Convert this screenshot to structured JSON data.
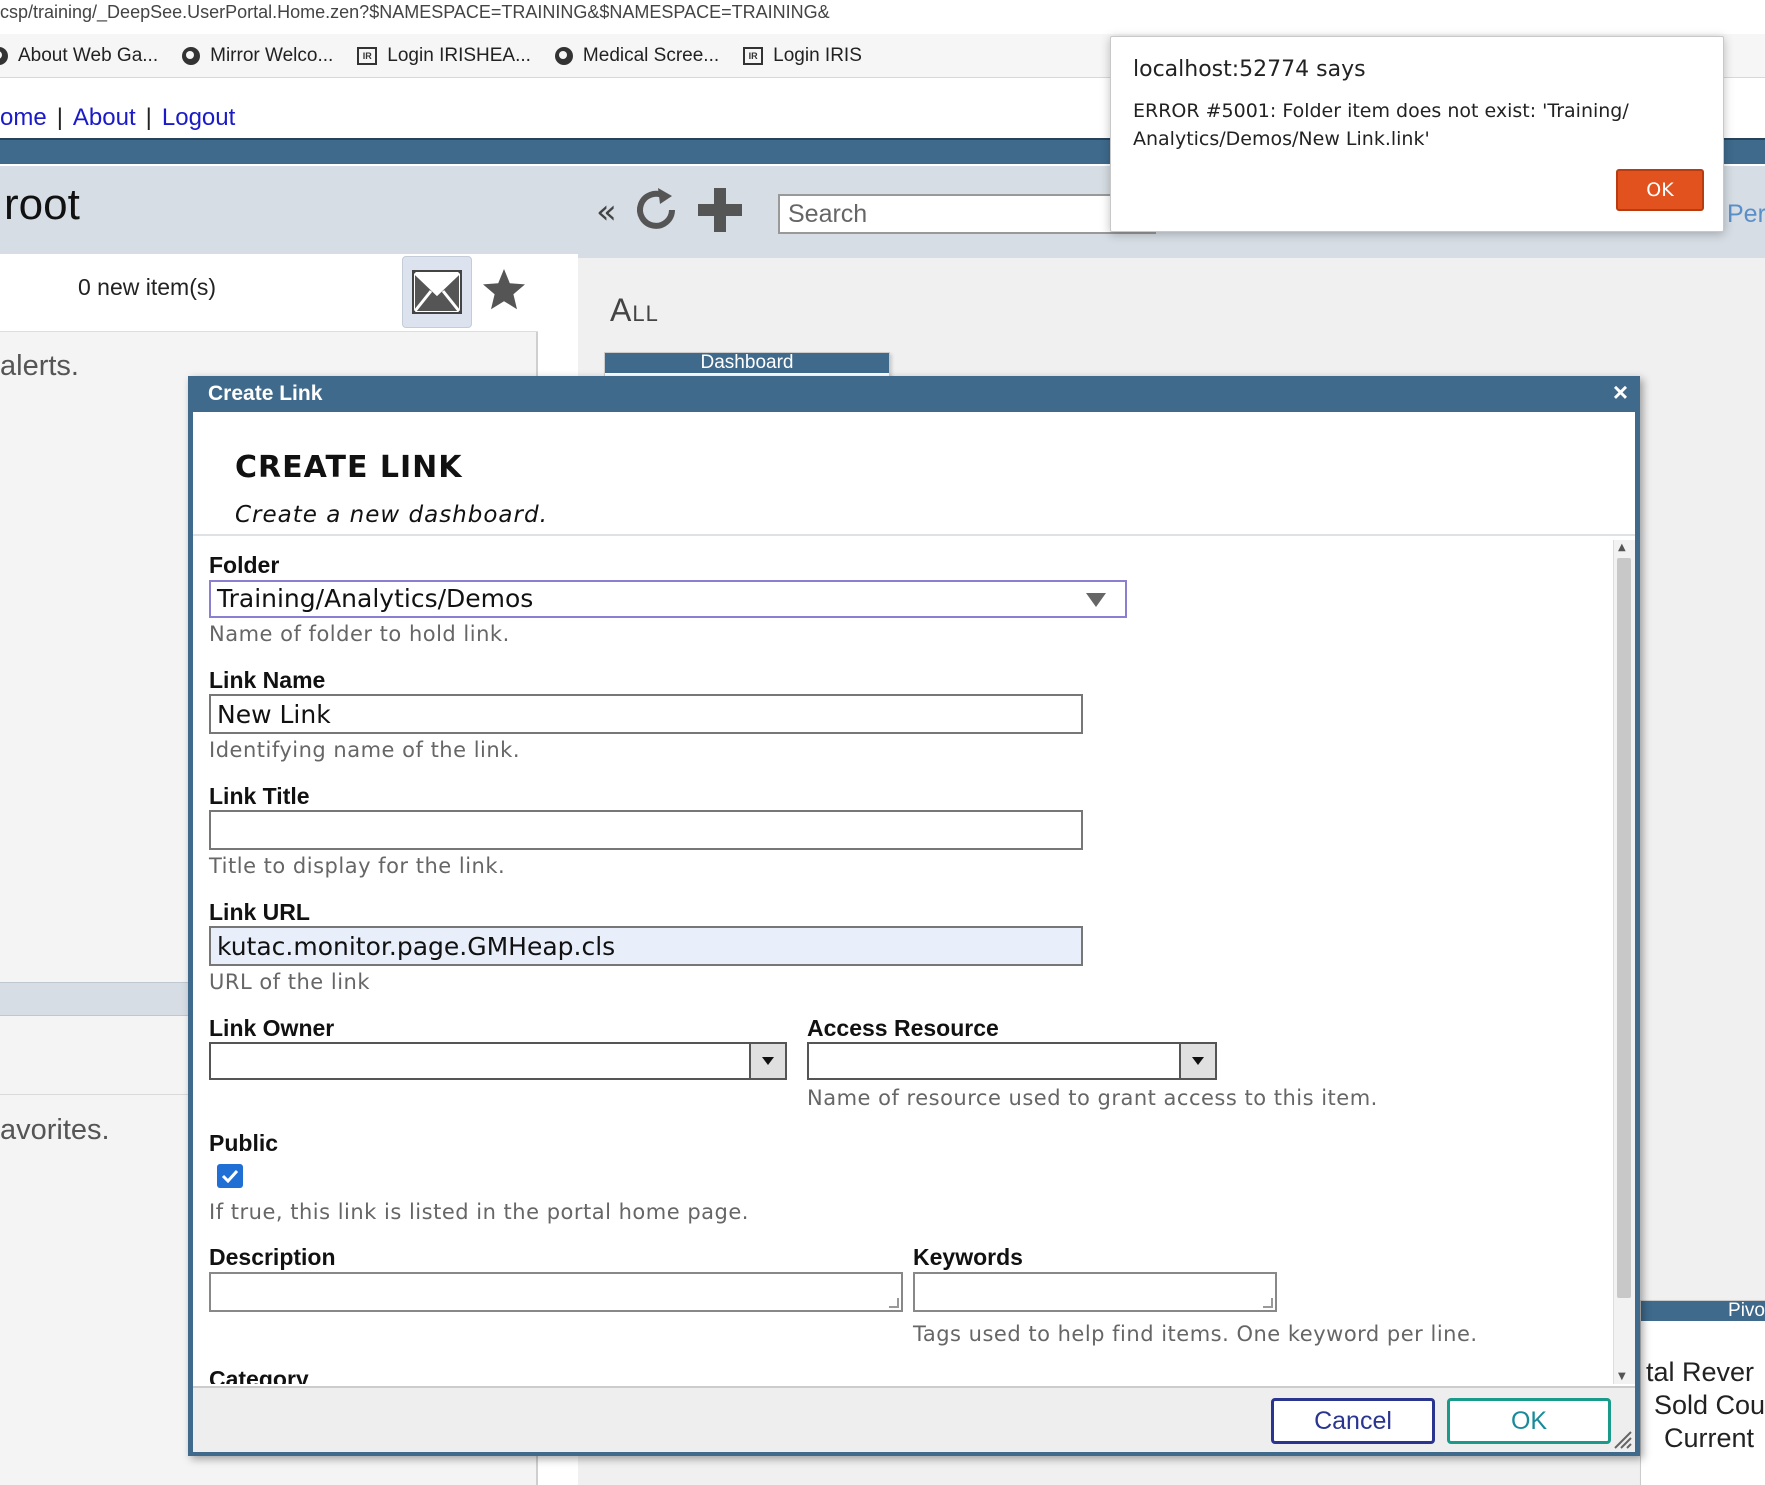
{
  "browser": {
    "url": "csp/training/_DeepSee.UserPortal.Home.zen?$NAMESPACE=TRAINING&$NAMESPACE=TRAINING&",
    "bookmarks": [
      {
        "label": "About Web Ga...",
        "icon": "globe-icon"
      },
      {
        "label": "Mirror Welco...",
        "icon": "globe-icon"
      },
      {
        "label": "Login IRISHEA...",
        "icon": "iris-icon"
      },
      {
        "label": "Medical Scree...",
        "icon": "globe-icon"
      },
      {
        "label": "Login IRIS",
        "icon": "iris-icon"
      }
    ]
  },
  "nav": {
    "home": "ome",
    "about": "About",
    "logout": "Logout",
    "sep": "|"
  },
  "left": {
    "title": "root",
    "new_items": "0 new item(s)",
    "alerts": "alerts.",
    "favorites": "avorites."
  },
  "right": {
    "collapse": "«",
    "search_placeholder": "Search",
    "per_link": "Per",
    "heading": "All",
    "tile_dashboard": "Dashboard",
    "tile_pivot": "Pivo",
    "pivot_lines": [
      "tal Rever",
      "Sold Cou",
      "Current"
    ]
  },
  "dialog": {
    "title": "Create Link",
    "close": "×",
    "heading": "CREATE LINK",
    "subtitle": "Create a new dashboard.",
    "folder": {
      "label": "Folder",
      "value": "Training/Analytics/Demos",
      "hint": "Name of folder to hold link."
    },
    "link_name": {
      "label": "Link Name",
      "value": "New Link",
      "hint": "Identifying name of the link."
    },
    "link_title": {
      "label": "Link Title",
      "value": "",
      "hint": "Title to display for the link."
    },
    "link_url": {
      "label": "Link URL",
      "value": "kutac.monitor.page.GMHeap.cls",
      "hint": "URL of the link"
    },
    "link_owner": {
      "label": "Link Owner",
      "value": ""
    },
    "access_resource": {
      "label": "Access Resource",
      "value": "",
      "hint": "Name of resource used to grant access to this item."
    },
    "public": {
      "label": "Public",
      "checked": true,
      "hint": "If true, this link is listed in the portal home page."
    },
    "description": {
      "label": "Description",
      "value": ""
    },
    "keywords": {
      "label": "Keywords",
      "value": "",
      "hint": "Tags used to help find items. One keyword per line."
    },
    "category": {
      "label": "Category"
    },
    "cancel": "Cancel",
    "ok": "OK"
  },
  "alert": {
    "title": "localhost:52774 says",
    "message": "ERROR #5001: Folder item does not exist: 'Training/ Analytics/Demos/New Link.link'",
    "ok": "OK"
  },
  "colors": {
    "accent": "#3f6a8c",
    "alert_ok": "#e2521f",
    "link": "#1a1ac8"
  }
}
